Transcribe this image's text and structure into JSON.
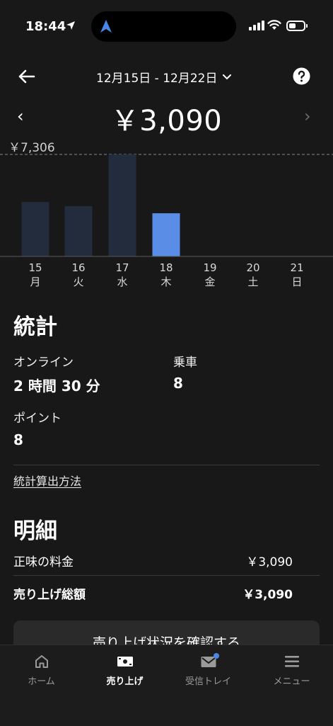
{
  "status_bar": {
    "time": "18:44"
  },
  "header": {
    "date_range": "12月15日 - 12月22日",
    "total": "￥3,090"
  },
  "chart_data": {
    "type": "bar",
    "max_label": "￥7,306",
    "categories": [
      {
        "day": "15",
        "weekday": "月"
      },
      {
        "day": "16",
        "weekday": "火"
      },
      {
        "day": "17",
        "weekday": "水"
      },
      {
        "day": "18",
        "weekday": "木"
      },
      {
        "day": "19",
        "weekday": "金"
      },
      {
        "day": "20",
        "weekday": "土"
      },
      {
        "day": "21",
        "weekday": "日"
      }
    ],
    "values": [
      3900,
      3600,
      7306,
      3090,
      0,
      0,
      0
    ],
    "ymax": 7306,
    "highlight_index": 3,
    "bar_color": "#222c3c",
    "highlight_color": "#5a8ee6"
  },
  "stats": {
    "title": "統計",
    "online_label": "オンライン",
    "online_value": "2 時間 30 分",
    "rides_label": "乗車",
    "rides_value": "8",
    "points_label": "ポイント",
    "points_value": "8",
    "method_link": "統計算出方法"
  },
  "details": {
    "title": "明細",
    "net_label": "正味の料金",
    "net_value": "￥3,090",
    "gross_label": "売り上げ総額",
    "gross_value": "￥3,090"
  },
  "cta": {
    "label": "売り上げ状況を確認する"
  },
  "tabs": [
    {
      "label": "ホーム"
    },
    {
      "label": "売り上げ"
    },
    {
      "label": "受信トレイ"
    },
    {
      "label": "メニュー"
    }
  ]
}
